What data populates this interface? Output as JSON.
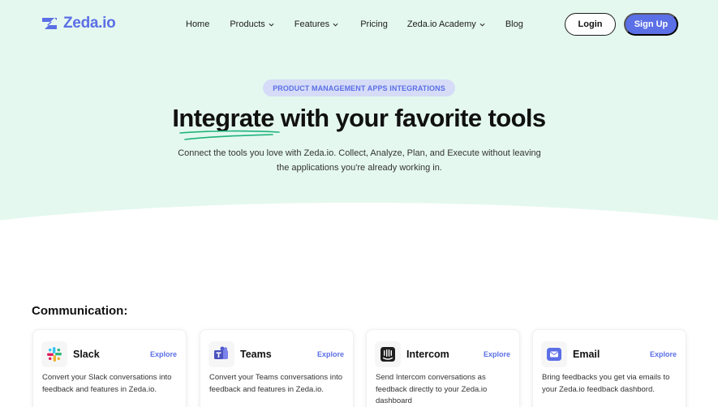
{
  "brand": {
    "name": "Zeda.io",
    "accent": "#5b6fe6"
  },
  "nav": {
    "items": [
      {
        "label": "Home",
        "dropdown": false
      },
      {
        "label": "Products",
        "dropdown": true
      },
      {
        "label": "Features",
        "dropdown": true
      },
      {
        "label": "Pricing",
        "dropdown": false
      },
      {
        "label": "Zeda.io Academy",
        "dropdown": true
      },
      {
        "label": "Blog",
        "dropdown": false
      }
    ],
    "login": "Login",
    "signup": "Sign Up"
  },
  "hero": {
    "pill": "PRODUCT MANAGEMENT APPS INTEGRATIONS",
    "title": "Integrate with your favorite tools",
    "subtitle": "Connect the tools you love with Zeda.io. Collect, Analyze, Plan, and Execute without leaving the applications you're already working in."
  },
  "section": {
    "title": "Communication:",
    "cards": [
      {
        "icon": "slack-icon",
        "title": "Slack",
        "explore": "Explore",
        "desc": "Convert your Slack conversations into feedback and features in Zeda.io."
      },
      {
        "icon": "teams-icon",
        "title": "Teams",
        "explore": "Explore",
        "desc": "Convert your Teams conversations into feedback and features in Zeda.io."
      },
      {
        "icon": "intercom-icon",
        "title": "Intercom",
        "explore": "Explore",
        "desc": "Send Intercom conversations as feedback directly to your Zeda.io dashboard"
      },
      {
        "icon": "email-icon",
        "title": "Email",
        "explore": "Explore",
        "desc": "Bring feedbacks you get via emails to your Zeda.io feedback dashbord."
      }
    ]
  }
}
